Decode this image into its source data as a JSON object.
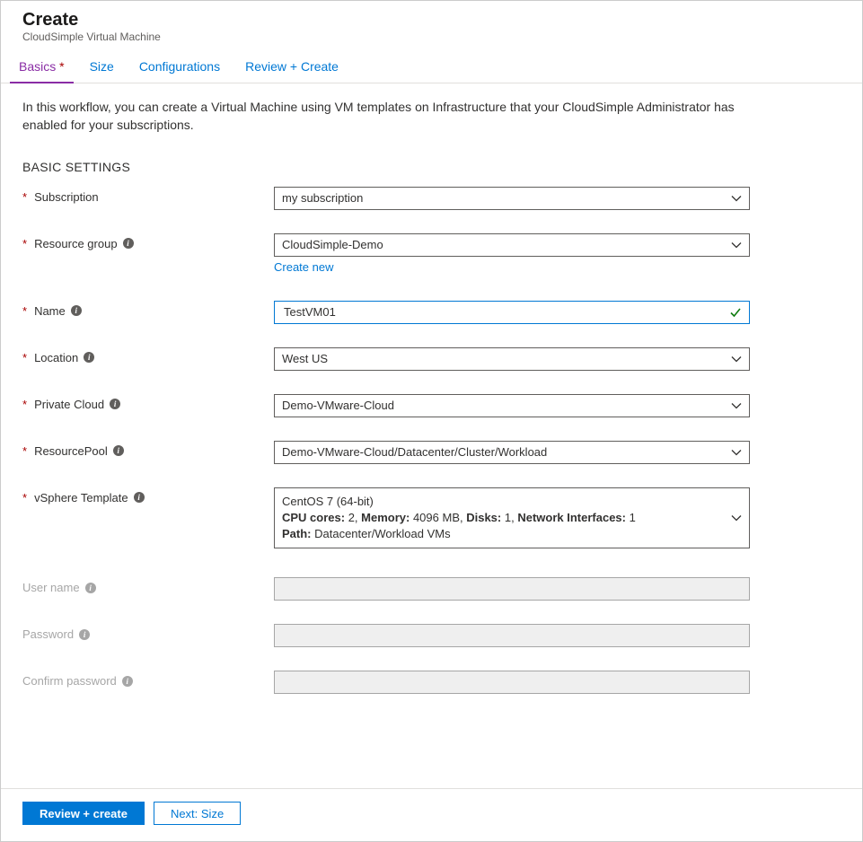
{
  "header": {
    "title": "Create",
    "subtitle": "CloudSimple Virtual Machine"
  },
  "tabs": {
    "basics": "Basics",
    "size": "Size",
    "configurations": "Configurations",
    "review": "Review + Create"
  },
  "intro": "In this workflow, you can create a Virtual Machine using VM templates on Infrastructure that your CloudSimple Administrator has enabled for your subscriptions.",
  "section_title": "BASIC SETTINGS",
  "fields": {
    "subscription": {
      "label": "Subscription",
      "value": "my subscription"
    },
    "resource_group": {
      "label": "Resource group",
      "value": "CloudSimple-Demo",
      "create_new": "Create new"
    },
    "name": {
      "label": "Name",
      "value": "TestVM01"
    },
    "location": {
      "label": "Location",
      "value": "West US"
    },
    "private_cloud": {
      "label": "Private Cloud",
      "value": "Demo-VMware-Cloud"
    },
    "resource_pool": {
      "label": "ResourcePool",
      "value": "Demo-VMware-Cloud/Datacenter/Cluster/Workload"
    },
    "template": {
      "label": "vSphere Template",
      "line1": "CentOS 7 (64-bit)",
      "cpu_label": "CPU cores:",
      "cpu": " 2, ",
      "mem_label": "Memory:",
      "mem": " 4096 MB, ",
      "disks_label": "Disks:",
      "disks": " 1, ",
      "net_label": "Network Interfaces:",
      "net": " 1",
      "path_label": "Path:",
      "path": " Datacenter/Workload VMs"
    },
    "username": {
      "label": "User name"
    },
    "password": {
      "label": "Password"
    },
    "confirm": {
      "label": "Confirm password"
    }
  },
  "footer": {
    "review": "Review + create",
    "next": "Next: Size"
  }
}
